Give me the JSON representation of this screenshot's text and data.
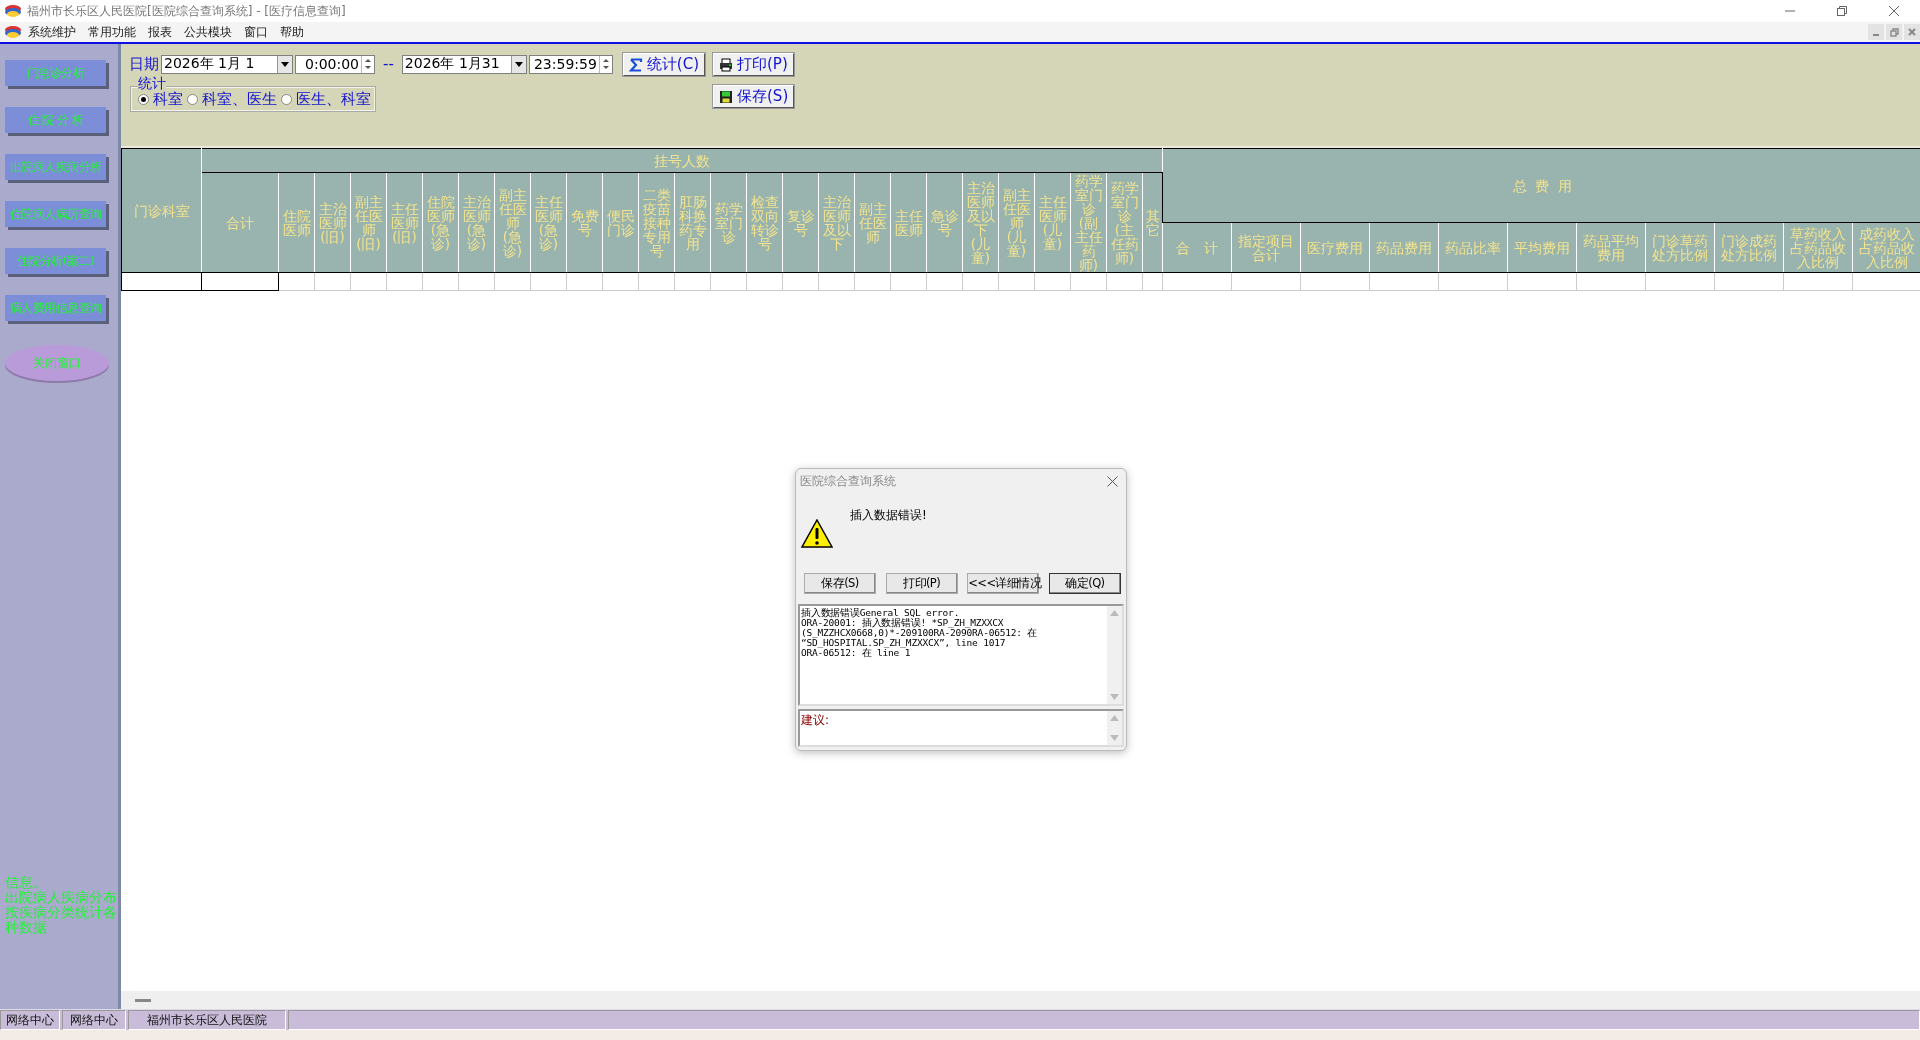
{
  "window": {
    "title": "福州市长乐区人民医院[医院综合查询系统] - [医疗信息查询]"
  },
  "menu_bar": {
    "items": [
      "系统维护",
      "常用功能",
      "报表",
      "公共模块",
      "窗口",
      "帮助"
    ]
  },
  "sidebar": {
    "buttons": [
      {
        "label": "门急诊分析",
        "kind": "rect"
      },
      {
        "label": "住 院 分 析",
        "kind": "rect"
      },
      {
        "label": "出院病人疾病分析",
        "kind": "rect"
      },
      {
        "label": "住院病人病历查询",
        "kind": "rect"
      },
      {
        "label": "住院分析(案二)",
        "kind": "rect"
      },
      {
        "label": "病人费用信息查询",
        "kind": "rect"
      },
      {
        "label": "关闭窗口",
        "kind": "oval"
      }
    ],
    "info": [
      "信息。",
      "出院病人疾病分布按疾病分类统计各种数据"
    ]
  },
  "filters": {
    "date_label": "日期",
    "start_date": "2026年 1月 1",
    "start_time": "0:00:00",
    "separator": "--",
    "end_date": "2026年 1月31",
    "end_time": "23:59:59",
    "stat_group": {
      "title": "统计",
      "options": [
        {
          "label": "科室",
          "selected": true
        },
        {
          "label": "科室、医生",
          "selected": false
        },
        {
          "label": "医生、科室",
          "selected": false
        }
      ]
    },
    "buttons": [
      {
        "label": "统计(C)",
        "kind": "sum"
      },
      {
        "label": "打印(P)",
        "kind": "print"
      },
      {
        "label": "保存(S)",
        "kind": "save"
      }
    ]
  },
  "table": {
    "first_column": "门诊科室",
    "groups": [
      {
        "title": "挂号人数",
        "kind": "registrations",
        "columns": [
          "合计",
          "住院医师",
          "主治医师(旧)",
          "副主任医师(旧)",
          "主任医师(旧)",
          "住院医师(急诊)",
          "主治医师(急诊)",
          "副主任医师(急诊)",
          "主任医师(急诊)",
          "免费号",
          "便民门诊",
          "二类疫苗接种专用号",
          "肛肠科换药专用",
          "药学室门诊",
          "检查双向转诊号",
          "复诊号",
          "主治医师及以下",
          "副主任医师",
          "主任医师",
          "急诊号",
          "主治医师及以下(儿童)",
          "副主任医师(儿童)",
          "主任医师(儿童)",
          "药学室门诊(副主任药师)",
          "药学室门诊(主任药师)",
          "其它"
        ]
      },
      {
        "title": "总 费 用",
        "kind": "fees",
        "columns": [
          "合　计",
          "指定项目合计",
          "医疗费用",
          "药品费用",
          "药品比率",
          "平均费用",
          "药品平均费用",
          "门诊草药处方比例",
          "门诊成药处方比例",
          "草药收入占药品收入比例",
          "成药收入占药品收入比例"
        ]
      }
    ]
  },
  "dialog": {
    "title": "医院综合查询系统",
    "message": "插入数据错误!",
    "buttons": [
      "保存(S)",
      "打印(P)",
      "<<<详细情况",
      "确定(Q)"
    ],
    "details": "插入数据错误General SQL error.\nORA-20001: 插入数据错误! *SP_ZH_MZXXCX\n(S_MZZHCX0668,0)*-209100RA-2090RA-06512: 在\n“SD_HOSPITAL.SP_ZH_MZXXCX”, line 1017\nORA-06512: 在 line 1",
    "suggestion_label": "建议:"
  },
  "status_bar": [
    "网络中心",
    "网络中心",
    "福州市长乐区人民医院"
  ]
}
